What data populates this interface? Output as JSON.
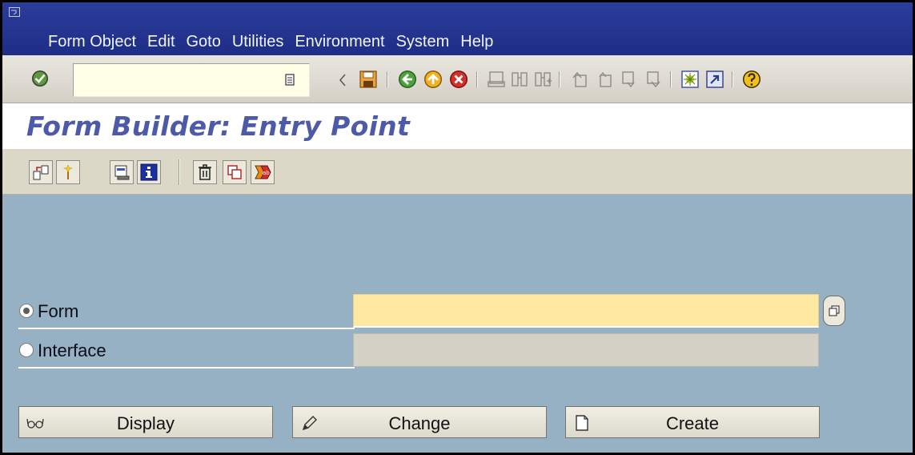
{
  "menu": {
    "items": [
      "Form Object",
      "Edit",
      "Goto",
      "Utilities",
      "Environment",
      "System",
      "Help"
    ]
  },
  "command_field": {
    "value": ""
  },
  "title": {
    "text": "Form Builder: Entry Point"
  },
  "form_selection": {
    "options": [
      {
        "label": "Form",
        "selected": true,
        "value": ""
      },
      {
        "label": "Interface",
        "selected": false,
        "value": ""
      }
    ]
  },
  "actions": {
    "display_label": "Display",
    "change_label": "Change",
    "create_label": "Create"
  },
  "colors": {
    "menubar": "#24348f",
    "title_text": "#4c5aa8",
    "content_bg": "#95b1c3",
    "required_field": "#fde9a2"
  }
}
